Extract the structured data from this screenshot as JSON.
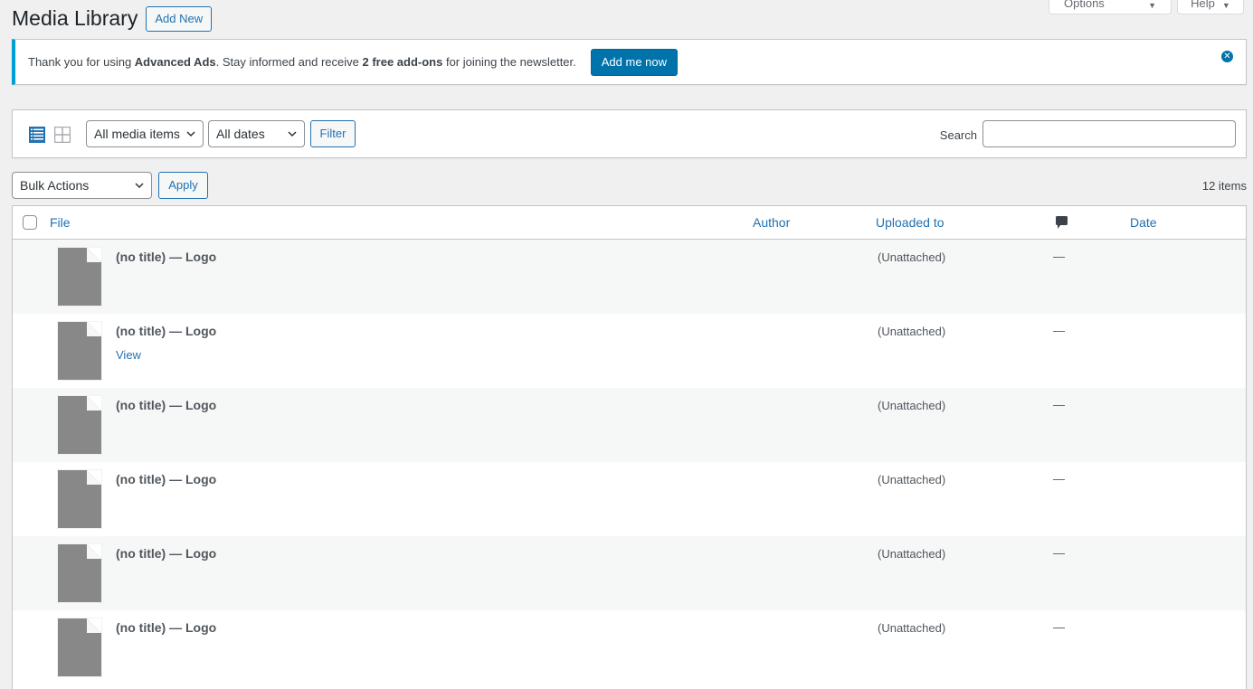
{
  "screen_meta": {
    "screen_options_label": "Screen Options",
    "help_label": "Help",
    "arrow": "▼"
  },
  "header": {
    "title": "Media Library",
    "add_new_label": "Add New"
  },
  "notice": {
    "text_before": "Thank you for using ",
    "bold1": "Advanced Ads",
    "text_middle": ". Stay informed and receive ",
    "bold2": "2 free add-ons",
    "text_after": " for joining the newsletter.",
    "button_label": "Add me now",
    "close_glyph": "✕",
    "accent_color": "#00a0d2",
    "button_color": "#0073aa"
  },
  "filters": {
    "view_list_icon": "list-view-icon",
    "view_grid_icon": "grid-view-icon",
    "media_type_selected": "All media items",
    "date_selected": "All dates",
    "filter_label": "Filter",
    "search_label": "Search",
    "search_value": ""
  },
  "bulk": {
    "selected": "Bulk Actions",
    "apply_label": "Apply",
    "items_count": "12 items"
  },
  "table": {
    "columns": {
      "file": "File",
      "author": "Author",
      "uploaded_to": "Uploaded to",
      "comments_icon": "comment-bubble-icon",
      "date": "Date"
    },
    "rows": [
      {
        "title": "(no title) — Logo",
        "author": "",
        "uploaded_to": "(Unattached)",
        "comments": "—",
        "date": "",
        "action": ""
      },
      {
        "title": "(no title) — Logo",
        "author": "",
        "uploaded_to": "(Unattached)",
        "comments": "—",
        "date": "",
        "action": "View"
      },
      {
        "title": "(no title) — Logo",
        "author": "",
        "uploaded_to": "(Unattached)",
        "comments": "—",
        "date": "",
        "action": ""
      },
      {
        "title": "(no title) — Logo",
        "author": "",
        "uploaded_to": "(Unattached)",
        "comments": "—",
        "date": "",
        "action": ""
      },
      {
        "title": "(no title) — Logo",
        "author": "",
        "uploaded_to": "(Unattached)",
        "comments": "—",
        "date": "",
        "action": ""
      },
      {
        "title": "(no title) — Logo",
        "author": "",
        "uploaded_to": "(Unattached)",
        "comments": "—",
        "date": "",
        "action": ""
      }
    ]
  }
}
